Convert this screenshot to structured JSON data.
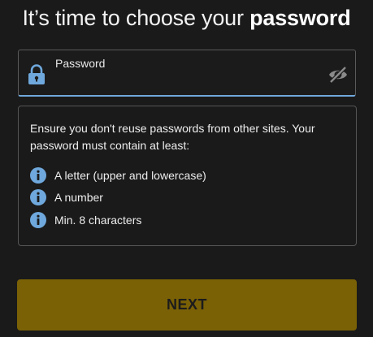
{
  "header": {
    "title_regular": "It’s time to choose your ",
    "title_bold": "password"
  },
  "password_field": {
    "label": "Password",
    "value": "",
    "lock_icon": "lock-icon",
    "visibility_icon": "eye-off-icon"
  },
  "requirements": {
    "intro": "Ensure you don't reuse passwords from other sites. Your password must contain at least:",
    "items": [
      {
        "text": "A letter (upper and lowercase)",
        "icon": "info-icon"
      },
      {
        "text": "A number",
        "icon": "info-icon"
      },
      {
        "text": "Min. 8 characters",
        "icon": "info-icon"
      }
    ]
  },
  "actions": {
    "next_label": "NEXT"
  },
  "colors": {
    "background": "#1a1a1a",
    "accent_blue": "#6fa8dc",
    "button_gold": "#7a6106"
  }
}
